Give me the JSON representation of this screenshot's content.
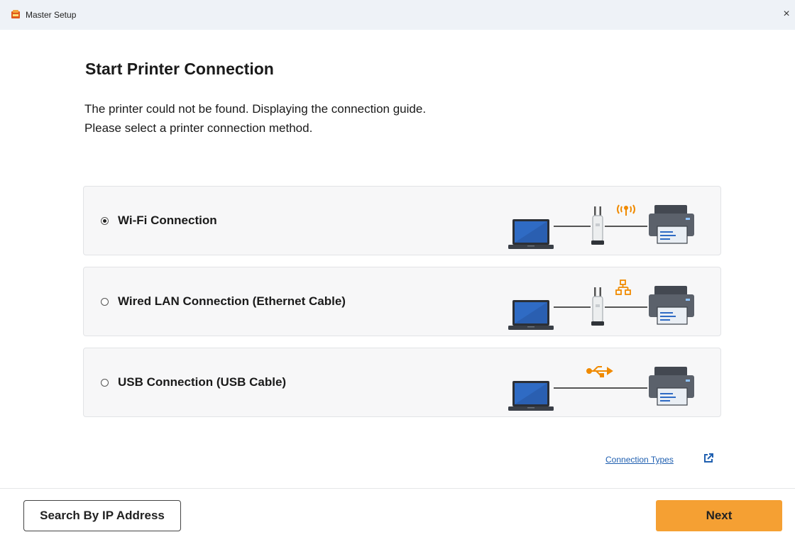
{
  "window": {
    "title": "Master Setup",
    "icon": "master-setup-app-icon",
    "close_glyph": "×"
  },
  "page": {
    "heading": "Start Printer Connection",
    "desc_line1": "The printer could not be found. Displaying the connection guide.",
    "desc_line2": "Please select a printer connection method."
  },
  "options": [
    {
      "label": "Wi-Fi Connection",
      "selected": true,
      "illustration": "laptop-router-wifi-printer"
    },
    {
      "label": "Wired LAN Connection (Ethernet Cable)",
      "selected": false,
      "illustration": "laptop-router-lan-printer"
    },
    {
      "label": "USB Connection (USB Cable)",
      "selected": false,
      "illustration": "laptop-usb-printer"
    }
  ],
  "links": {
    "connection_types": "Connection Types",
    "external_icon": "external-link-icon"
  },
  "buttons": {
    "search_ip": "Search By IP Address",
    "next": "Next"
  },
  "colors": {
    "accent": "#f5a033",
    "link": "#1f5fb0",
    "illustration_accent": "#f08a00"
  }
}
